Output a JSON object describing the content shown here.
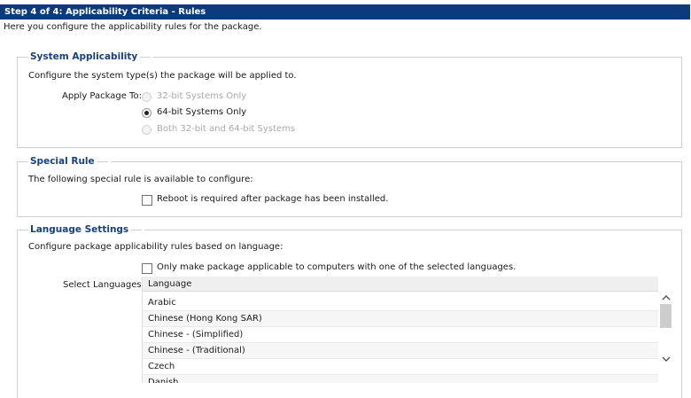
{
  "header": {
    "title": "Step 4 of 4: Applicability Criteria - Rules"
  },
  "subtitle": "Here you configure the applicability rules for the package.",
  "system": {
    "legend": "System Applicability",
    "description": "Configure the system type(s) the package will be applied to.",
    "apply_label": "Apply Package To:",
    "options": [
      {
        "label": "32-bit Systems Only",
        "enabled": false,
        "selected": false
      },
      {
        "label": "64-bit Systems Only",
        "enabled": true,
        "selected": true
      },
      {
        "label": "Both 32-bit and 64-bit Systems",
        "enabled": false,
        "selected": false
      }
    ]
  },
  "special": {
    "legend": "Special Rule",
    "description": "The following special rule is available to configure:",
    "reboot_label": "Reboot is required after package has been installed.",
    "reboot_checked": false
  },
  "language": {
    "legend": "Language Settings",
    "description": "Configure package applicability rules based on language:",
    "only_label": "Only make package applicable to computers with one of the selected languages.",
    "only_checked": false,
    "select_label": "Select Languages:",
    "column_header": "Language",
    "items": [
      "Arabic",
      "Chinese (Hong Kong SAR)",
      "Chinese - (Simplified)",
      "Chinese - (Traditional)",
      "Czech",
      "Danish"
    ]
  },
  "icons": {
    "scroll_up": "chevron-up-icon",
    "scroll_down": "chevron-down-icon"
  },
  "colors": {
    "header_bg": "#0d3a7a",
    "legend_text": "#17407f"
  }
}
